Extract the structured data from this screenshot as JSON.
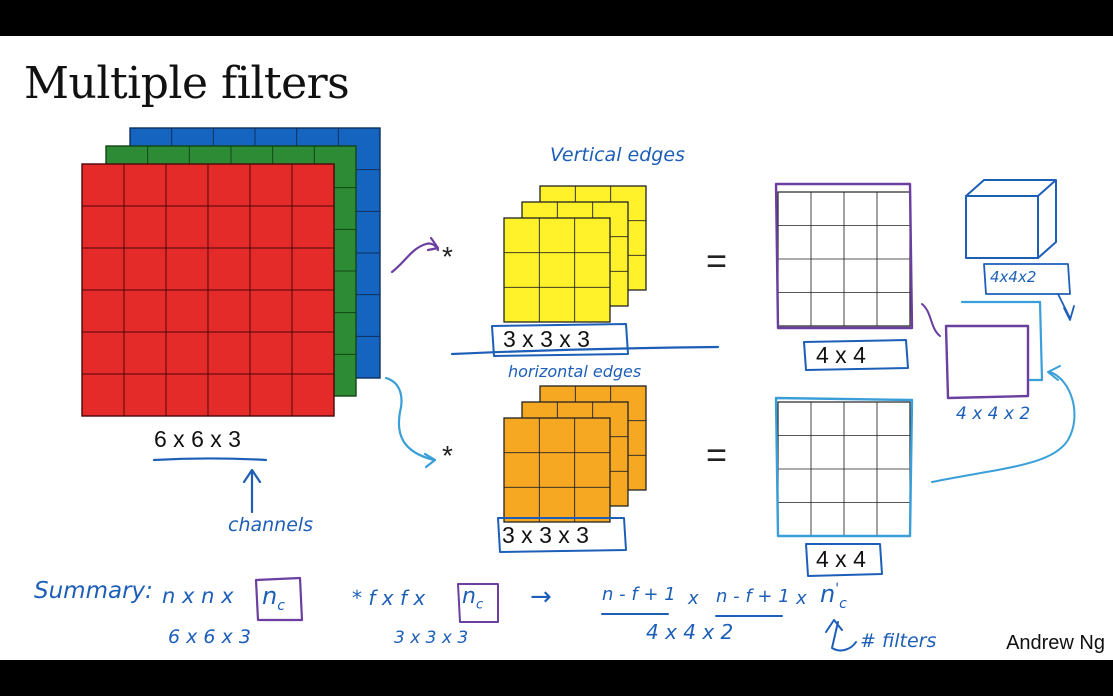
{
  "slide": {
    "title": "Multiple filters",
    "author": "Andrew Ng"
  },
  "input_volume": {
    "dims_label": "6 x 6 x 3",
    "channel_colors": [
      "#1565c0",
      "#2e8b35",
      "#e52a2a"
    ],
    "note": "channels"
  },
  "filters": [
    {
      "dims_label": "3 x 3 x 3",
      "color": "#fff22a",
      "note": "Vertical edges"
    },
    {
      "dims_label": "3 x 3 x 3",
      "color": "#f7a823",
      "note": "horizontal edges"
    }
  ],
  "outputs": [
    {
      "dims_label": "4 x 4"
    },
    {
      "dims_label": "4 x 4"
    }
  ],
  "stacked_output": {
    "label": "4 x 4 x 2",
    "cube_label": "4x4x2"
  },
  "operators": {
    "convolve": "*",
    "equals": "="
  },
  "summary": {
    "label": "Summary:",
    "input_expr": "n x n x",
    "input_channels": "n",
    "input_channels_sub": "c",
    "input_example": "6 x 6 x 3",
    "filter_expr": "* f x f x",
    "filter_channels": "n",
    "filter_channels_sub": "c",
    "filter_example": "3 x 3 x 3",
    "arrow": "→",
    "out_term_1": "n - f + 1",
    "out_term_2": "n - f + 1",
    "times": "x",
    "out_channels": "n",
    "out_channels_sub": "c",
    "out_channels_prime": "'",
    "out_example": "4   x   4   x 2",
    "filters_note": "# filters"
  }
}
